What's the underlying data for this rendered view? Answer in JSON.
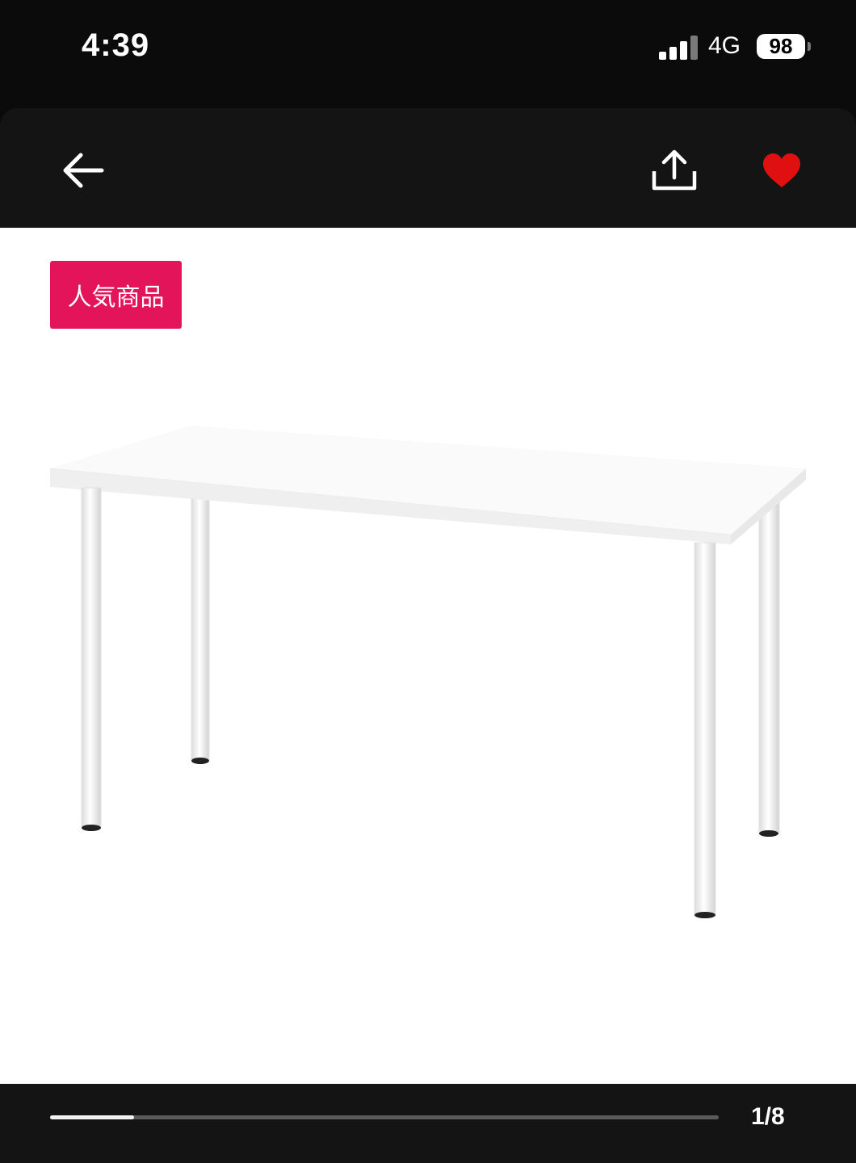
{
  "status_bar": {
    "time": "4:39",
    "network": "4G",
    "battery": "98",
    "signal_bars_active": 3,
    "signal_bars_total": 4
  },
  "nav": {
    "back_icon": "arrow-left-icon",
    "share_icon": "share-upload-icon",
    "favorite_icon": "heart-icon",
    "favorite_color": "#e01010"
  },
  "product": {
    "badge": "人気商品",
    "badge_color": "#e4145a",
    "image": "white-desk-table"
  },
  "gallery": {
    "counter": "1/8",
    "current": 1,
    "total": 8
  }
}
